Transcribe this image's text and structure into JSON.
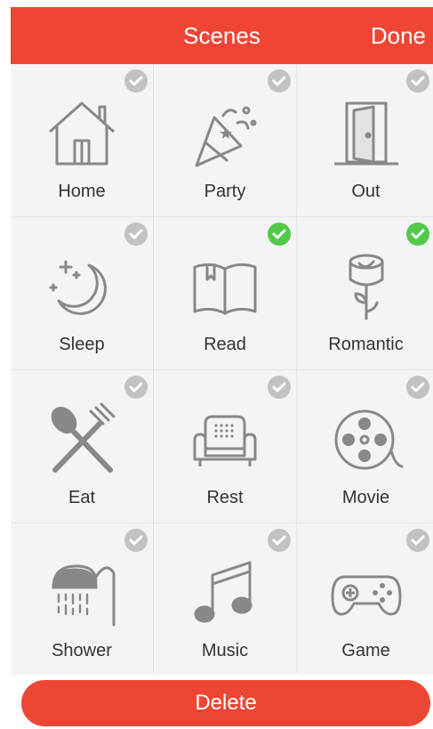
{
  "header": {
    "title": "Scenes",
    "done_label": "Done"
  },
  "scenes": [
    {
      "label": "Home",
      "icon": "home-icon",
      "selected": false
    },
    {
      "label": "Party",
      "icon": "party-popper-icon",
      "selected": false
    },
    {
      "label": "Out",
      "icon": "door-icon",
      "selected": false
    },
    {
      "label": "Sleep",
      "icon": "moon-stars-icon",
      "selected": false
    },
    {
      "label": "Read",
      "icon": "open-book-icon",
      "selected": true
    },
    {
      "label": "Romantic",
      "icon": "rose-icon",
      "selected": true
    },
    {
      "label": "Eat",
      "icon": "fork-spoon-icon",
      "selected": false
    },
    {
      "label": "Rest",
      "icon": "sofa-icon",
      "selected": false
    },
    {
      "label": "Movie",
      "icon": "film-reel-icon",
      "selected": false
    },
    {
      "label": "Shower",
      "icon": "shower-icon",
      "selected": false
    },
    {
      "label": "Music",
      "icon": "music-note-icon",
      "selected": false
    },
    {
      "label": "Game",
      "icon": "gamepad-icon",
      "selected": false
    }
  ],
  "footer": {
    "delete_label": "Delete"
  },
  "colors": {
    "accent": "#f04534",
    "selected_check": "#52c94a",
    "unselected_check": "#c2c2c2",
    "icon_gray": "#888888"
  }
}
